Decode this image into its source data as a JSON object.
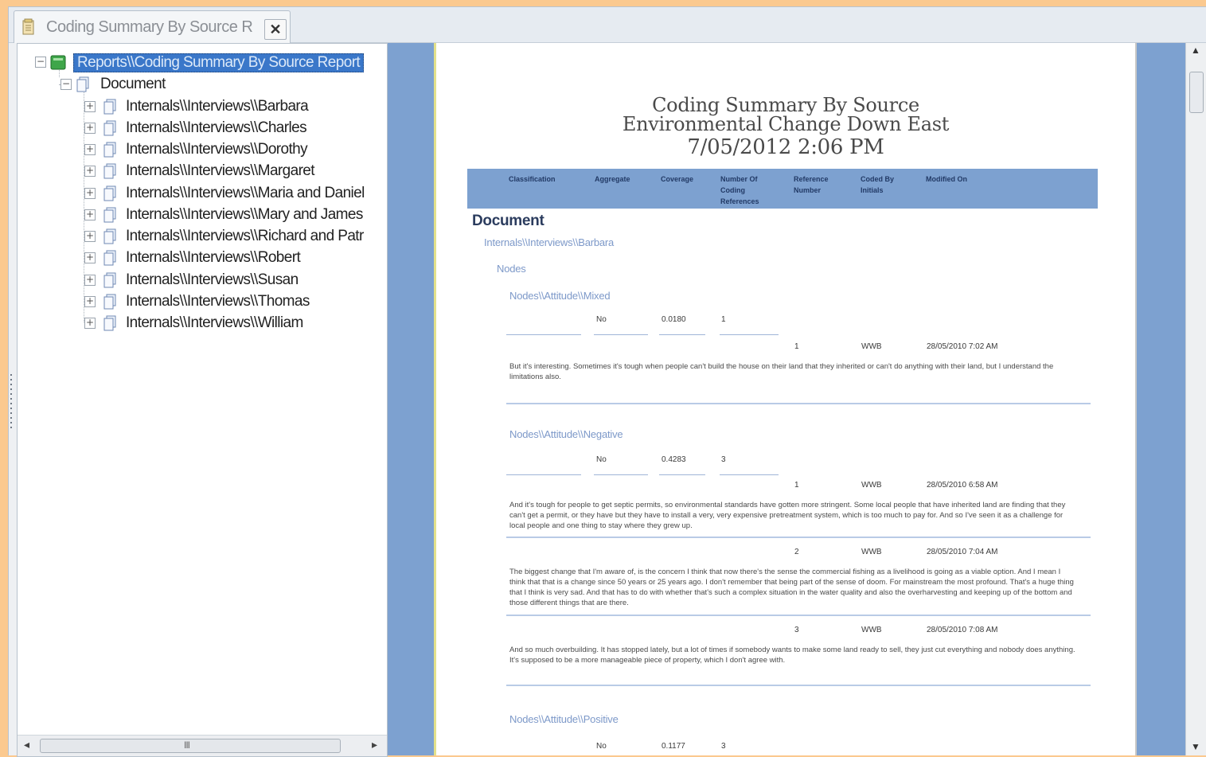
{
  "tab": {
    "title": "Coding Summary By Source R",
    "close_symbol": "✕"
  },
  "tree": {
    "root": "Reports\\\\Coding Summary By Source Report",
    "folder": "Document",
    "items": [
      "Internals\\\\Interviews\\\\Barbara",
      "Internals\\\\Interviews\\\\Charles",
      "Internals\\\\Interviews\\\\Dorothy",
      "Internals\\\\Interviews\\\\Margaret",
      "Internals\\\\Interviews\\\\Maria and Daniel",
      "Internals\\\\Interviews\\\\Mary and James",
      "Internals\\\\Interviews\\\\Richard and Patr",
      "Internals\\\\Interviews\\\\Robert",
      "Internals\\\\Interviews\\\\Susan",
      "Internals\\\\Interviews\\\\Thomas",
      "Internals\\\\Interviews\\\\William"
    ],
    "hscroll_grip": "III"
  },
  "report": {
    "title_line1": "Coding Summary By Source",
    "title_line2": "Environmental Change Down East",
    "title_line3": "7/05/2012 2:06 PM",
    "columns": [
      "Classification",
      "Aggregate",
      "Coverage",
      "Number Of Coding References",
      "Reference Number",
      "Coded By Initials",
      "Modified On"
    ],
    "section": "Document",
    "source": "Internals\\\\Interviews\\\\Barbara",
    "group": "Nodes",
    "nodes": [
      {
        "name": "Nodes\\\\Attitude\\\\Mixed",
        "aggregate": "No",
        "coverage": "0.0180",
        "refs": "1",
        "references": [
          {
            "number": "1",
            "initials": "WWB",
            "modified": "28/05/2010 7:02 AM",
            "text": "But it's interesting. Sometimes it's tough when people can't build the house on their land that they inherited or can't do anything with their land, but I understand the limitations also."
          }
        ]
      },
      {
        "name": "Nodes\\\\Attitude\\\\Negative",
        "aggregate": "No",
        "coverage": "0.4283",
        "refs": "3",
        "references": [
          {
            "number": "1",
            "initials": "WWB",
            "modified": "28/05/2010 6:58 AM",
            "text": "And it's tough for people to get septic permits, so environmental standards have gotten more stringent. Some local people that have inherited land are finding that they can't get a permit, or they have but they have to install a very, very expensive pretreatment system, which is too much to pay for. And so I've seen it as a challenge for local people and one thing to stay where they grew up."
          },
          {
            "number": "2",
            "initials": "WWB",
            "modified": "28/05/2010 7:04 AM",
            "text": "The biggest change that I'm aware of, is the concern I think that now there's the sense the commercial fishing as a livelihood is going as a viable option. And I mean I think that that is a change since 50 years or 25 years ago. I don't remember that being part of the sense of doom. For mainstream the most profound. That's a huge thing that I think is very sad. And that has to do with whether that's such a complex situation in the water quality and also the overharvesting and keeping up of the bottom and those different things that are there."
          },
          {
            "number": "3",
            "initials": "WWB",
            "modified": "28/05/2010 7:08 AM",
            "text": "And so much overbuilding. It has stopped lately, but a lot of times if somebody wants to make some land ready to sell, they just cut everything and nobody does anything. It's supposed to be a more manageable piece of property, which I don't agree with."
          }
        ]
      },
      {
        "name": "Nodes\\\\Attitude\\\\Positive",
        "aggregate": "No",
        "coverage": "0.1177",
        "refs": "3",
        "references": []
      }
    ]
  }
}
